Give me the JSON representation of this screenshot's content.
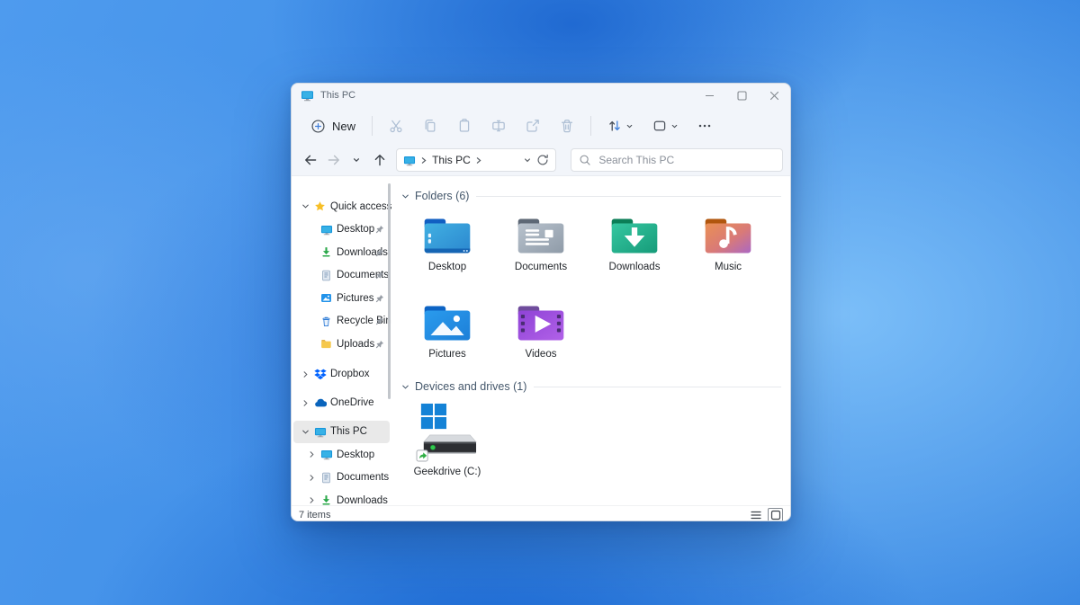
{
  "window": {
    "title": "This PC"
  },
  "toolbar": {
    "new_label": "New",
    "icons": [
      "plus-circle-icon",
      "cut-icon",
      "copy-icon",
      "paste-icon",
      "rename-icon",
      "share-icon",
      "delete-icon",
      "sort-icon",
      "view-icon",
      "more-icon"
    ]
  },
  "navigation": {
    "icons": [
      "back-icon",
      "forward-icon",
      "recent-locations-chevron-icon",
      "up-icon",
      "refresh-icon"
    ],
    "breadcrumb": {
      "root_icon": "monitor-icon",
      "path": "This PC"
    },
    "search_placeholder": "Search This PC"
  },
  "sidebar": {
    "quick_access": {
      "label": "Quick access",
      "icon": "star-icon",
      "items": [
        {
          "label": "Desktop",
          "icon": "desktop-monitor-icon",
          "pinned": true
        },
        {
          "label": "Downloads",
          "icon": "download-arrow-icon",
          "pinned": true
        },
        {
          "label": "Documents",
          "icon": "document-icon",
          "pinned": true
        },
        {
          "label": "Pictures",
          "icon": "picture-icon",
          "pinned": true
        },
        {
          "label": "Recycle Bin",
          "icon": "recycle-bin-icon",
          "pinned": true
        },
        {
          "label": "Uploads",
          "icon": "folder-icon",
          "pinned": true
        }
      ]
    },
    "cloud_items": [
      {
        "label": "Dropbox",
        "icon": "dropbox-icon"
      },
      {
        "label": "OneDrive",
        "icon": "onedrive-icon"
      }
    ],
    "this_pc": {
      "label": "This PC",
      "icon": "monitor-icon",
      "selected": true,
      "children": [
        {
          "label": "Desktop",
          "icon": "desktop-monitor-icon"
        },
        {
          "label": "Documents",
          "icon": "document-icon"
        },
        {
          "label": "Downloads",
          "icon": "download-arrow-icon"
        }
      ]
    }
  },
  "content": {
    "folders_section": {
      "title": "Folders (6)",
      "items": [
        {
          "name": "Desktop"
        },
        {
          "name": "Documents"
        },
        {
          "name": "Downloads"
        },
        {
          "name": "Music"
        },
        {
          "name": "Pictures"
        },
        {
          "name": "Videos"
        }
      ]
    },
    "devices_section": {
      "title": "Devices and drives (1)",
      "items": [
        {
          "name": "Geekdrive (C:)"
        }
      ]
    }
  },
  "status_bar": {
    "items_count": "7 items",
    "view_icons": [
      "details-view-icon",
      "large-thumbnails-view-icon"
    ]
  },
  "colors": {
    "accent": "#0078d4",
    "selection_bg": "#e9e9e9",
    "wallpaper_base": "#3d8de8"
  }
}
